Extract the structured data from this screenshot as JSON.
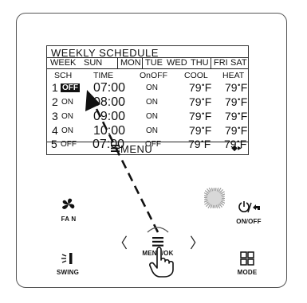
{
  "lcd": {
    "title": "WEEKLY SCHEDULE",
    "days": [
      "WEEK",
      "SUN",
      "MON",
      "TUE",
      "WED",
      "THU",
      "FRI",
      "SAT"
    ],
    "headers": {
      "sch": "SCH",
      "time": "TIME",
      "onoff": "OnOFF",
      "cool": "COOL",
      "heat": "HEAT"
    },
    "rows": [
      {
        "n": "1",
        "state": "OFF",
        "time": "07:00",
        "onoff": "ON",
        "cool": "79",
        "heat": "79"
      },
      {
        "n": "2",
        "state": "ON",
        "time": "08:00",
        "onoff": "ON",
        "cool": "79",
        "heat": "79"
      },
      {
        "n": "3",
        "state": "ON",
        "time": "09:00",
        "onoff": "ON",
        "cool": "79",
        "heat": "79"
      },
      {
        "n": "4",
        "state": "ON",
        "time": "10:00",
        "onoff": "ON",
        "cool": "79",
        "heat": "79"
      },
      {
        "n": "5",
        "state": "OFF",
        "time": "07:00",
        "onoff": "OFF",
        "cool": "79",
        "heat": "79"
      }
    ],
    "unit": "F",
    "menu_label": "MENU"
  },
  "buttons": {
    "fan": "FA N",
    "onoff": "ON/OFF",
    "menu_ok": "MENU/OK",
    "swing": "SWING",
    "mode": "MODE",
    "left": "〈",
    "right": "〉"
  },
  "icons": {
    "fan": "fan-icon",
    "power": "power-icon",
    "back": "back-arrow-icon",
    "menu": "menu-lines-icon",
    "swing": "swing-icon",
    "mode": "mode-grid-icon",
    "hand": "pointing-hand-icon",
    "sensor": "sensor-grille-icon"
  }
}
